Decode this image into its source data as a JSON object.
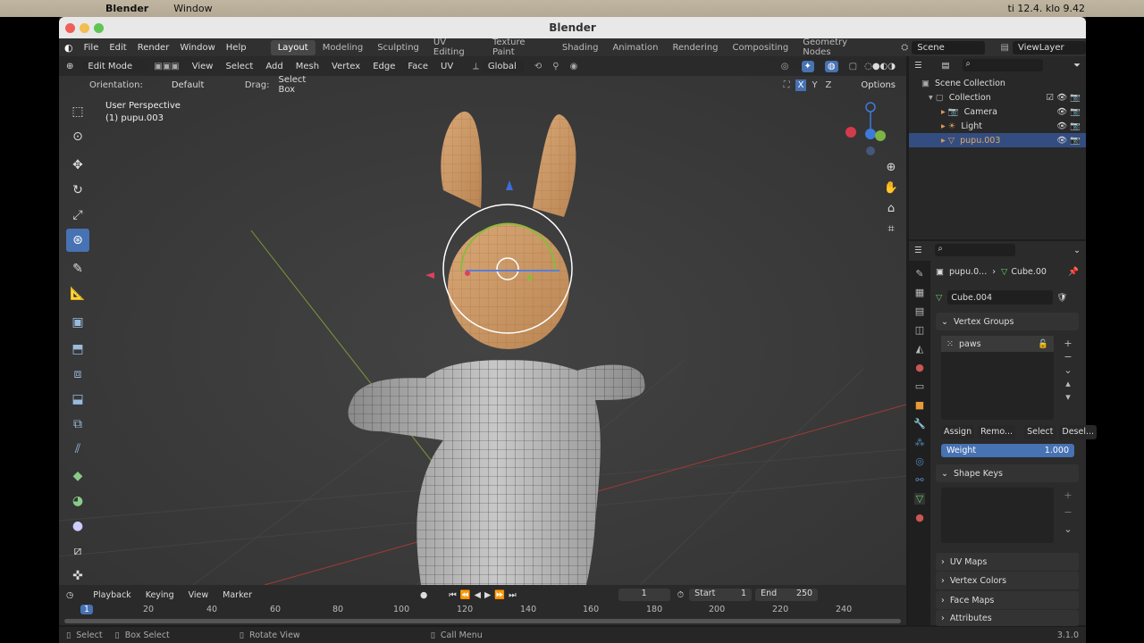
{
  "macbar": {
    "app": "Blender",
    "menu": "Window",
    "clock": "ti 12.4. klo 9.42"
  },
  "window": {
    "title": "Blender"
  },
  "menus": [
    "File",
    "Edit",
    "Render",
    "Window",
    "Help"
  ],
  "workspaces": [
    "Layout",
    "Modeling",
    "Sculpting",
    "UV Editing",
    "Texture Paint",
    "Shading",
    "Animation",
    "Rendering",
    "Compositing",
    "Geometry Nodes"
  ],
  "active_workspace": "Layout",
  "scene": "Scene",
  "view_layer": "ViewLayer",
  "viewport": {
    "mode": "Edit Mode",
    "menus": [
      "View",
      "Select",
      "Add",
      "Mesh",
      "Vertex",
      "Edge",
      "Face",
      "UV"
    ],
    "transform": "Global",
    "orientation_label": "Orientation:",
    "orientation": "Default",
    "drag_label": "Drag:",
    "drag": "Select Box",
    "options": "Options",
    "axes": [
      "X",
      "Y",
      "Z"
    ],
    "overlay_title": "User Perspective",
    "overlay_object": "(1) pupu.003"
  },
  "outliner": {
    "root": "Scene Collection",
    "collection": "Collection",
    "items": [
      "Camera",
      "Light",
      "pupu.003"
    ]
  },
  "properties": {
    "breadcrumb_object": "pupu.0...",
    "breadcrumb_mesh": "Cube.00",
    "mesh_name": "Cube.004",
    "vertex_groups_title": "Vertex Groups",
    "vertex_group": "paws",
    "assign": "Assign",
    "remove": "Remo...",
    "select": "Select",
    "deselect": "Desel...",
    "weight_label": "Weight",
    "weight_value": "1.000",
    "shape_keys": "Shape Keys",
    "uv_maps": "UV Maps",
    "vertex_colors": "Vertex Colors",
    "face_maps": "Face Maps",
    "attributes": "Attributes"
  },
  "timeline": {
    "menus": [
      "Playback",
      "Keying",
      "View",
      "Marker"
    ],
    "current_frame": "1",
    "start_label": "Start",
    "start": "1",
    "end_label": "End",
    "end": "250",
    "ticks": [
      "1",
      "20",
      "40",
      "60",
      "80",
      "100",
      "120",
      "140",
      "160",
      "180",
      "200",
      "220",
      "240"
    ]
  },
  "status": {
    "select": "Select",
    "box_select": "Box Select",
    "rotate_view": "Rotate View",
    "call_menu": "Call Menu",
    "version": "3.1.0"
  }
}
